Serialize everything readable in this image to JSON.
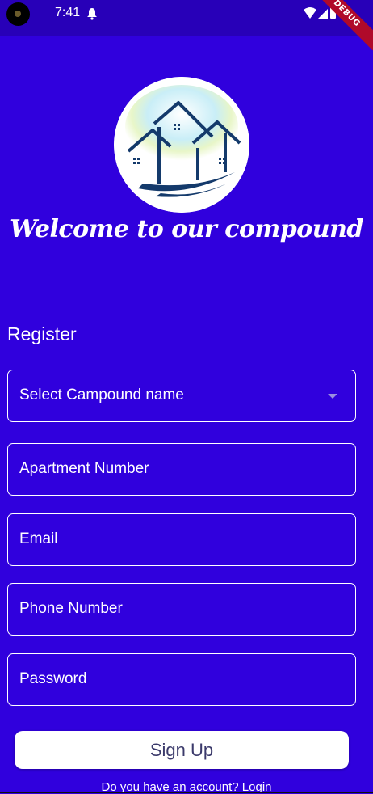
{
  "status_bar": {
    "time": "7:41",
    "debug_label": "DEBUG"
  },
  "header": {
    "welcome_text": "Welcome to our compound"
  },
  "form": {
    "title": "Register",
    "fields": [
      {
        "label": "Select Campound name"
      },
      {
        "label": "Apartment Number"
      },
      {
        "label": "Email"
      },
      {
        "label": "Phone Number"
      },
      {
        "label": "Password"
      }
    ],
    "submit_label": "Sign Up",
    "login_prompt": "Do you have an account? Login"
  },
  "colors": {
    "background": "#3000dd",
    "status_bar": "#2800b8",
    "logo_navy": "#143a6b"
  }
}
